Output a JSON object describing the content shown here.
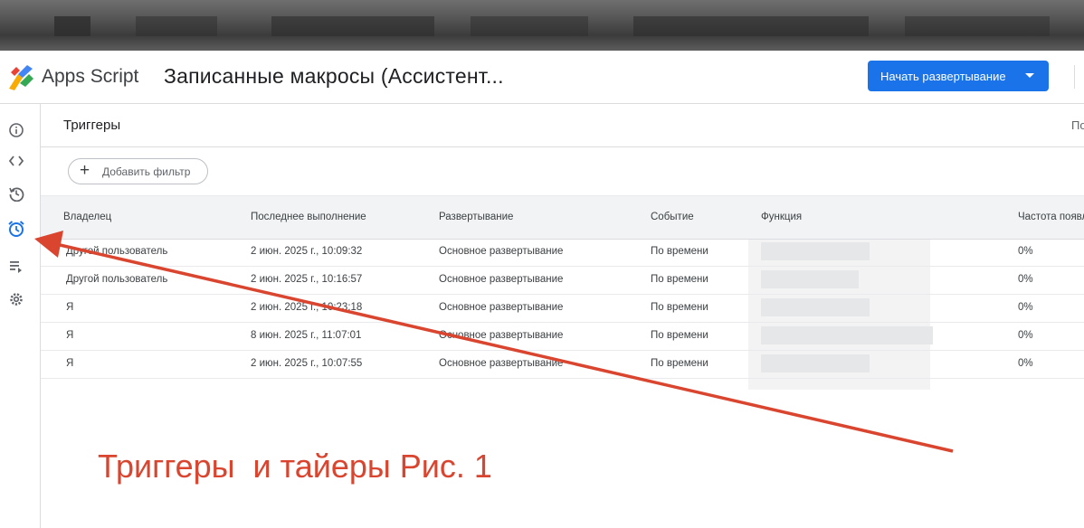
{
  "header": {
    "app_name": "Apps Script",
    "project_title": "Записанные макросы (Ассистент...",
    "deploy_label": "Начать развертывание"
  },
  "sidebar": {
    "items": [
      {
        "icon": "info-icon"
      },
      {
        "icon": "code-icon"
      },
      {
        "icon": "history-icon"
      },
      {
        "icon": "alarm-clock-icon",
        "active": true
      },
      {
        "icon": "executions-icon"
      },
      {
        "icon": "gear-icon"
      }
    ]
  },
  "page": {
    "title": "Триггеры",
    "right_label": "По",
    "add_filter_label": "Добавить фильтр"
  },
  "table": {
    "columns": [
      "Владелец",
      "Последнее выполнение",
      "Развертывание",
      "Событие",
      "Функция",
      "Частота появл"
    ],
    "rows": [
      {
        "owner": "Другой пользователь",
        "last_run": "2 июн. 2025 г., 10:09:32",
        "deployment": "Основное развертывание",
        "event": "По времени",
        "rate": "0%"
      },
      {
        "owner": "Другой пользователь",
        "last_run": "2 июн. 2025 г., 10:16:57",
        "deployment": "Основное развертывание",
        "event": "По времени",
        "rate": "0%"
      },
      {
        "owner": "Я",
        "last_run": "2 июн. 2025 г., 10:23:18",
        "deployment": "Основное развертывание",
        "event": "По времени",
        "rate": "0%"
      },
      {
        "owner": "Я",
        "last_run": "8 июн. 2025 г., 11:07:01",
        "deployment": "Основное развертывание",
        "event": "По времени",
        "rate": "0%"
      },
      {
        "owner": "Я",
        "last_run": "2 июн. 2025 г., 10:07:55",
        "deployment": "Основное развертывание",
        "event": "По времени",
        "rate": "0%"
      }
    ]
  },
  "annotation": {
    "caption": "Триггеры  и тайеры Рис. 1",
    "color": "#d9452f"
  },
  "colors": {
    "accent": "#1a73e8"
  }
}
